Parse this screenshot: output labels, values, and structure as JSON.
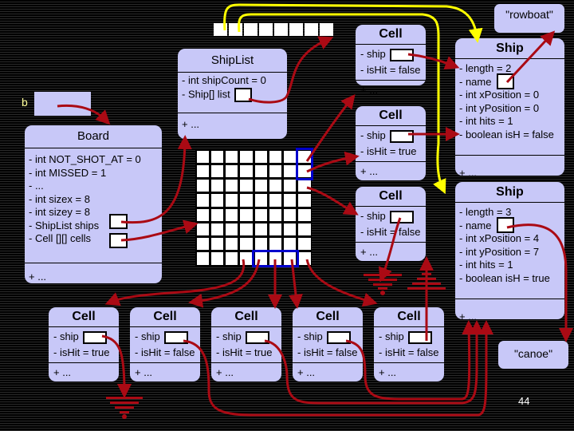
{
  "slide_number": "44",
  "variable_b": {
    "label": "b"
  },
  "ship_list": {
    "title": "ShipList",
    "fields": [
      "- int shipCount = 0",
      "- Ship[] list"
    ],
    "methods": "+ ..."
  },
  "board": {
    "title": "Board",
    "fields": [
      "- int NOT_SHOT_AT = 0",
      "- int MISSED = 1",
      "- ...",
      "- int sizex = 8",
      "- int sizey = 8",
      "- ShipList ships",
      "- Cell [][] cells"
    ],
    "methods": "+ ..."
  },
  "grid": {
    "rows": 8,
    "cols": 8,
    "highlight_color": "#0000cc"
  },
  "ship_array": {
    "length": 8
  },
  "right_cells": [
    {
      "title": "Cell",
      "ship": "- ship",
      "is_hit": "- isHit = false",
      "methods": "+ ..."
    },
    {
      "title": "Cell",
      "ship": "- ship",
      "is_hit": "- isHit = true",
      "methods": "+ ..."
    },
    {
      "title": "Cell",
      "ship": "- ship",
      "is_hit": "- isHit = false",
      "methods": "+ ..."
    }
  ],
  "bottom_cells": [
    {
      "title": "Cell",
      "ship": "- ship",
      "is_hit": "- isHit = true",
      "methods": "+ ..."
    },
    {
      "title": "Cell",
      "ship": "- ship",
      "is_hit": "- isHit = false",
      "methods": "+ ..."
    },
    {
      "title": "Cell",
      "ship": "- ship",
      "is_hit": "- isHit = true",
      "methods": "+ ..."
    },
    {
      "title": "Cell",
      "ship": "- ship",
      "is_hit": "- isHit = false",
      "methods": "+ ..."
    },
    {
      "title": "Cell",
      "ship": "- ship",
      "is_hit": "- isHit = false",
      "methods": "+ ..."
    }
  ],
  "ships": [
    {
      "title": "Ship",
      "fields": [
        "- length = 2",
        "- name",
        "- int xPosition = 0",
        "- int yPosition = 0",
        "- int hits = 1",
        "- boolean isH = false"
      ],
      "methods": "+ ..."
    },
    {
      "title": "Ship",
      "fields": [
        "- length = 3",
        "- name",
        "- int xPosition = 4",
        "- int yPosition = 7",
        "- int hits = 1",
        "- boolean isH = true"
      ],
      "methods": "+ ..."
    }
  ],
  "strings": {
    "rowboat": "\"rowboat\"",
    "canoe": "\"canoe\""
  },
  "colors": {
    "box": "#c8c8f8",
    "pointer": "#aa0a14",
    "ship_array_pointer": "#ffff00",
    "highlight": "#0000cc"
  }
}
